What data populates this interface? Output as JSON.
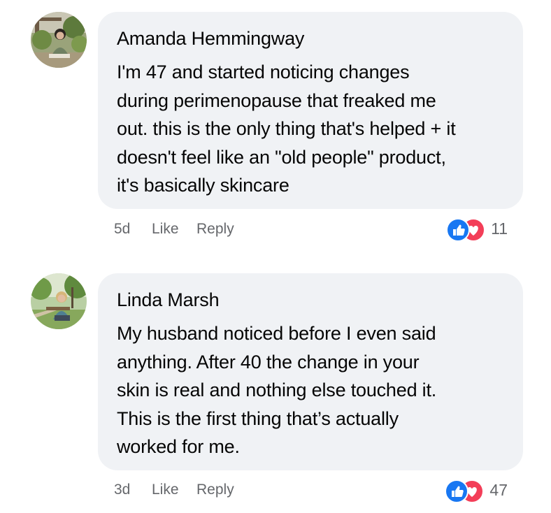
{
  "comments": [
    {
      "author": "Amanda Hemmingway",
      "lines": [
        "I'm 47 and started noticing changes",
        "during perimenopause that freaked me",
        "out. this is the only thing that's helped + it",
        "doesn't feel like an \"old people\" product,",
        "it's basically skincare"
      ],
      "time": "5d",
      "like_label": "Like",
      "reply_label": "Reply",
      "reaction_count": "11",
      "reactions": [
        "like-icon",
        "love-icon"
      ]
    },
    {
      "author": "Linda Marsh",
      "lines": [
        "My husband noticed before I even said",
        "anything. After 40 the change in your",
        "skin is real and nothing else touched it.",
        "This is the first thing that’s actually",
        "worked for me."
      ],
      "time": "3d",
      "like_label": "Like",
      "reply_label": "Reply",
      "reaction_count": "47",
      "reactions": [
        "like-icon",
        "love-icon"
      ]
    }
  ],
  "colors": {
    "bubble": "#f0f2f5",
    "text": "#050505",
    "meta": "#65676b",
    "like": "#1877f2",
    "love": "#f33e58"
  }
}
